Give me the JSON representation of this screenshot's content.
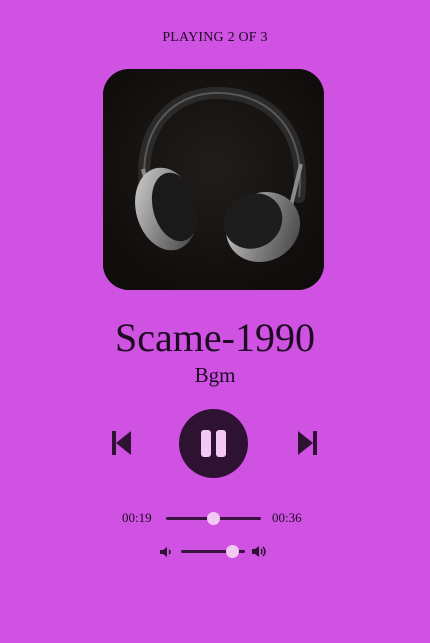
{
  "header": {
    "status_text": "PLAYING 2 OF 3"
  },
  "track": {
    "title": "Scame-1990",
    "artist": "Bgm",
    "cover_icon": "headphones-image"
  },
  "controls": {
    "prev_icon": "skip-previous-icon",
    "play_state_icon": "pause-icon",
    "next_icon": "skip-next-icon"
  },
  "progress": {
    "current_time": "00:19",
    "total_time": "00:36",
    "fraction": 0.5
  },
  "volume": {
    "low_icon": "volume-low-icon",
    "high_icon": "volume-high-icon",
    "fraction": 0.8
  },
  "colors": {
    "background": "#cf52e3",
    "accent_dark": "#2e1232",
    "thumb": "#f3c9f3"
  }
}
